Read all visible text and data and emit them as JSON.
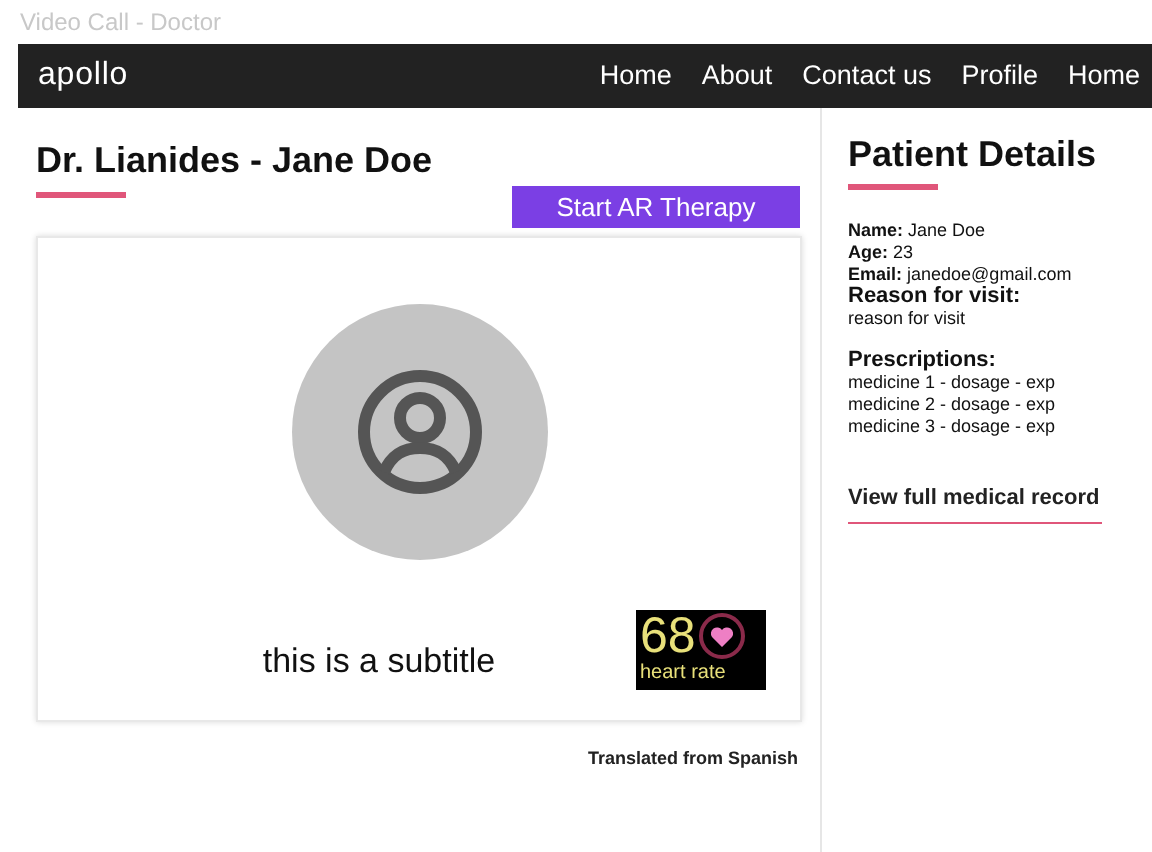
{
  "window": {
    "title": "Video Call - Doctor"
  },
  "navbar": {
    "brand": "apollo",
    "links": [
      "Home",
      "About",
      "Contact us",
      "Profile",
      "Home"
    ]
  },
  "call": {
    "title": "Dr. Lianides - Jane Doe",
    "button": "Start AR Therapy",
    "subtitle": "this is a subtitle",
    "heart_rate": {
      "value": "68",
      "label": "heart rate"
    },
    "translation_note": "Translated from Spanish"
  },
  "patient": {
    "title": "Patient Details",
    "details": [
      "**Name:** Jane Doe",
      "**Age:** 23",
      "**Email:** janedoe@gmail.com"
    ],
    "reason": {
      "label": "Reason for visit:",
      "value": "reason for visit"
    },
    "prescriptions": {
      "label": "Prescriptions:",
      "items": [
        "medicine 1 - dosage - exp",
        "medicine 2 - dosage - exp",
        "medicine 3 - dosage - exp"
      ]
    },
    "record_link": "View full medical record"
  }
}
